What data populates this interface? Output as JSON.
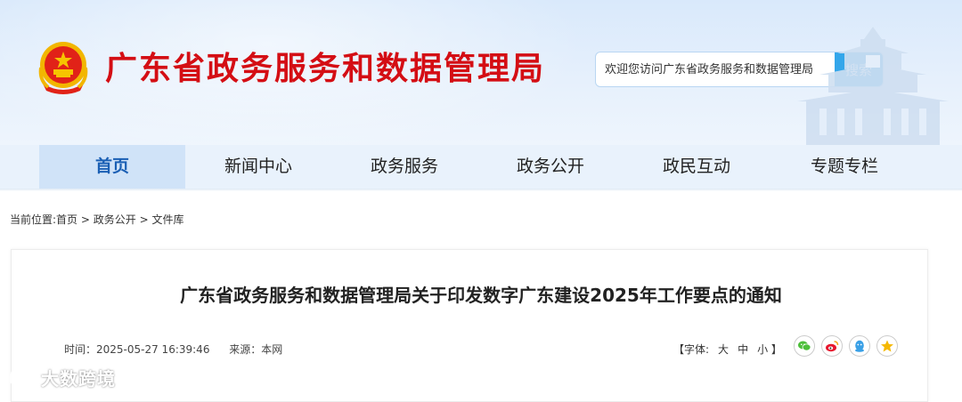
{
  "header": {
    "site_title": "广东省政务服务和数据管理局",
    "search_placeholder": "欢迎您访问广东省政务服务和数据管理局",
    "search_button": "搜索"
  },
  "nav": {
    "items": [
      {
        "label": "首页",
        "active": true
      },
      {
        "label": "新闻中心",
        "active": false
      },
      {
        "label": "政务服务",
        "active": false
      },
      {
        "label": "政务公开",
        "active": false
      },
      {
        "label": "政民互动",
        "active": false
      },
      {
        "label": "专题专栏",
        "active": false
      }
    ]
  },
  "breadcrumb": {
    "prefix": "当前位置:",
    "items": [
      "首页",
      "政务公开",
      "文件库"
    ],
    "separator": ">"
  },
  "article": {
    "title": "广东省政务服务和数据管理局关于印发数字广东建设2025年工作要点的通知",
    "time_label": "时间：2025-05-27 16:39:46",
    "source_label": "来源：本网",
    "fontsize_label": "【字体:",
    "fontsize_options": [
      "大",
      "中",
      "小"
    ],
    "fontsize_close": "】"
  },
  "share": {
    "icons": [
      "wechat-icon",
      "weibo-icon",
      "qq-icon",
      "qzone-icon"
    ]
  },
  "watermark": {
    "text": "大数跨境"
  },
  "colors": {
    "title_red": "#d40e14",
    "accent_blue": "#33a6ea",
    "nav_active_text": "#1a5fb4"
  }
}
